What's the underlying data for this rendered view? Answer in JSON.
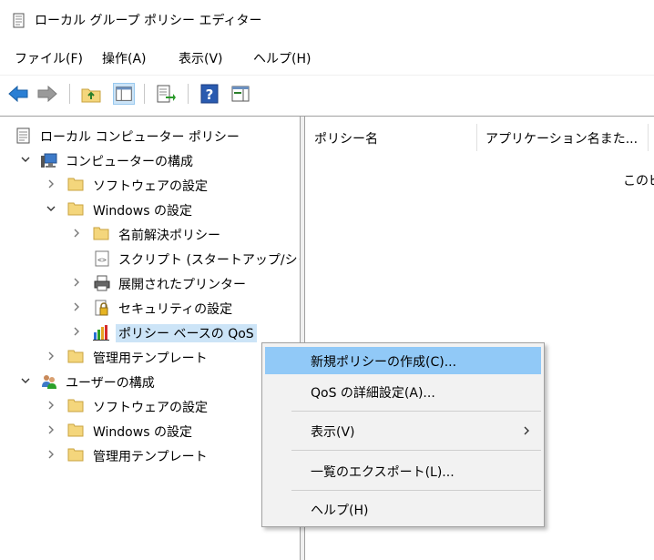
{
  "window": {
    "title": "ローカル グループ ポリシー エディター"
  },
  "menubar": {
    "file": "ファイル(F)",
    "action": "操作(A)",
    "view": "表示(V)",
    "help": "ヘルプ(H)"
  },
  "tree": {
    "root": "ローカル コンピューター ポリシー",
    "computer_config": "コンピューターの構成",
    "cc_software": "ソフトウェアの設定",
    "cc_windows": "Windows の設定",
    "name_resolution": "名前解決ポリシー",
    "scripts": "スクリプト (スタートアップ/シャ",
    "printers": "展開されたプリンター",
    "security": "セキュリティの設定",
    "qos": "ポリシー ベースの QoS",
    "cc_admin": "管理用テンプレート",
    "user_config": "ユーザーの構成",
    "uc_software": "ソフトウェアの設定",
    "uc_windows": "Windows の設定",
    "uc_admin": "管理用テンプレート"
  },
  "list": {
    "col_policy": "ポリシー名",
    "col_app": "アプリケーション名また...",
    "empty_text": "このビ"
  },
  "context_menu": {
    "new_policy": "新規ポリシーの作成(C)...",
    "qos_advanced": "QoS の詳細設定(A)...",
    "view": "表示(V)",
    "export": "一覧のエクスポート(L)...",
    "help": "ヘルプ(H)"
  },
  "colors": {
    "highlight": "#91c9f7",
    "menu_bg": "#f2f2f2",
    "folder": "#f4d67c"
  }
}
